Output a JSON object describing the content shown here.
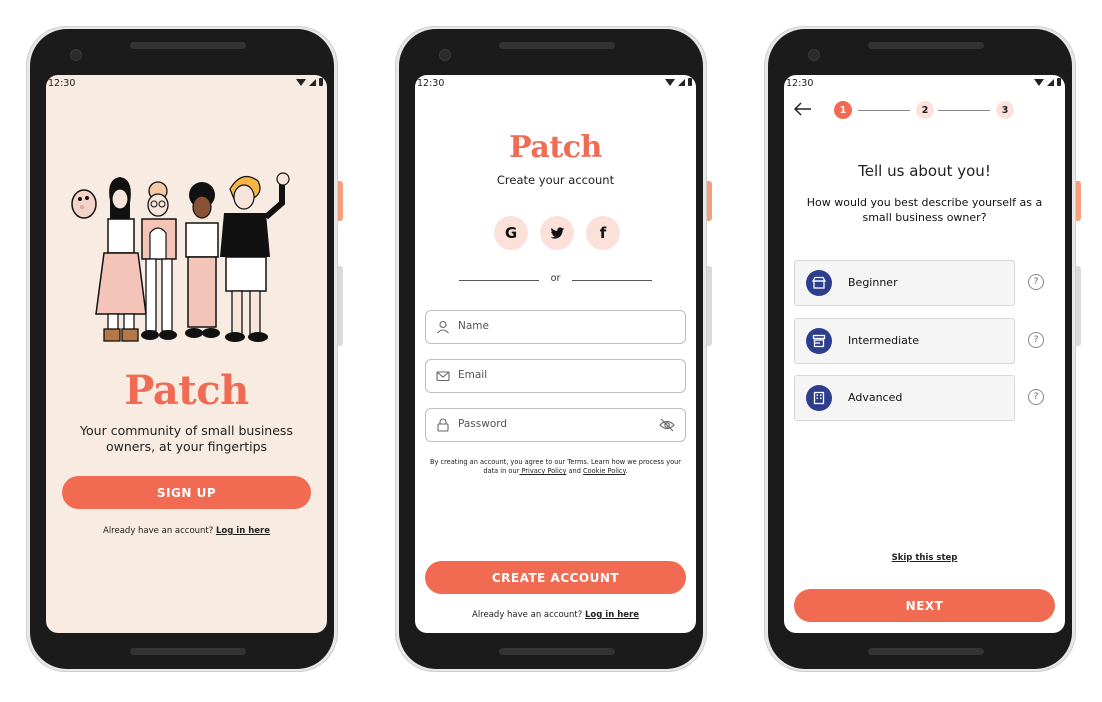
{
  "colors": {
    "accent": "#f06b52",
    "cream": "#f8ebe1",
    "navy": "#2e3e8f",
    "pink": "#fde2da"
  },
  "status": {
    "time": "12:30"
  },
  "welcome": {
    "logo": "Patch",
    "tagline": "Your community of small business owners, at your fingertips",
    "signup_label": "SIGN UP",
    "footer_prefix": "Already have an account? ",
    "footer_link": "Log in here"
  },
  "signup": {
    "logo": "Patch",
    "subtitle": "Create your account",
    "social": [
      {
        "icon": "google-icon",
        "glyph": "G"
      },
      {
        "icon": "twitter-icon",
        "glyph": ""
      },
      {
        "icon": "facebook-icon",
        "glyph": "f"
      }
    ],
    "divider": "or",
    "name_placeholder": "Name",
    "email_placeholder": "Email",
    "password_placeholder": "Password",
    "terms_prefix": "By creating an account, you agree to our Terms. Learn how we process your data in our",
    "privacy_link": " Privacy Policy",
    "terms_and": " and ",
    "cookie_link": "Cookie Policy",
    "terms_suffix": ".",
    "create_label": "CREATE ACCOUNT",
    "footer_prefix": "Already have an account? ",
    "footer_link": "Log in here"
  },
  "onboarding": {
    "steps": [
      "1",
      "2",
      "3"
    ],
    "current_step": 1,
    "title": "Tell us about you!",
    "question": "How would you best describe yourself as a small business owner?",
    "options": [
      {
        "label": "Beginner",
        "icon": "shop-awning-icon"
      },
      {
        "label": "Intermediate",
        "icon": "storefront-icon"
      },
      {
        "label": "Advanced",
        "icon": "building-icon"
      }
    ],
    "help_glyph": "?",
    "skip_label": "Skip this step",
    "next_label": "NEXT"
  }
}
